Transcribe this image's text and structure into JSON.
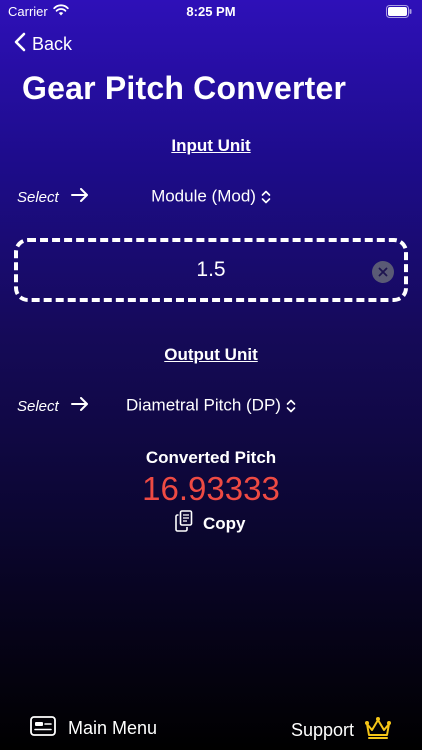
{
  "status_bar": {
    "carrier": "Carrier",
    "time": "8:25 PM",
    "icons": [
      "wifi-icon",
      "battery-icon"
    ]
  },
  "nav": {
    "back_label": "Back",
    "back_icon": "chevron-left-icon"
  },
  "title": "Gear Pitch Converter",
  "input_section": {
    "label": "Input Unit",
    "select_hint": "Select",
    "selected_unit": "Module (Mod)",
    "value": "1.5",
    "clear_icon": "clear-icon"
  },
  "output_section": {
    "label": "Output Unit",
    "select_hint": "Select",
    "selected_unit": "Diametral Pitch (DP)"
  },
  "result": {
    "label": "Converted Pitch",
    "value": "16.93333",
    "copy_label": "Copy",
    "value_color": "#ee4a43"
  },
  "footer": {
    "main_menu_label": "Main Menu",
    "support_label": "Support",
    "icons": [
      "menu-card-icon",
      "crown-icon"
    ],
    "crown_color": "#f5c518"
  }
}
